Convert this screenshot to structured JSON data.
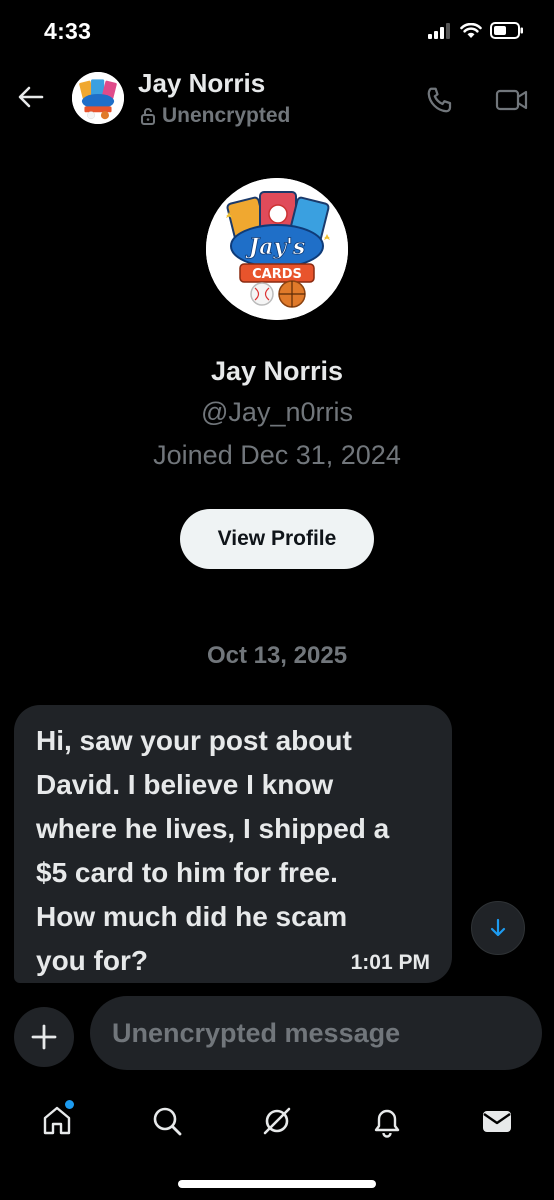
{
  "status_bar": {
    "time": "4:33"
  },
  "header": {
    "back_icon": "arrow-left-icon",
    "contact_name": "Jay Norris",
    "encryption_status": "Unencrypted",
    "call_icon": "phone-icon",
    "video_icon": "video-camera-icon"
  },
  "avatar": {
    "logo_text_top": "Jay's",
    "logo_text_bottom": "CARDS"
  },
  "profile": {
    "name": "Jay Norris",
    "handle": "@Jay_n0rris",
    "joined": "Joined Dec 31, 2024",
    "view_profile_label": "View Profile"
  },
  "conversation": {
    "date_divider": "Oct 13, 2025",
    "messages": [
      {
        "text": "Hi, saw your post about\nDavid. I believe I know\nwhere he lives, I shipped a\n$5 card to him for free.\nHow much did he scam\nyou for?",
        "time": "1:01 PM"
      }
    ]
  },
  "composer": {
    "placeholder": "Unencrypted message",
    "add_icon": "plus-icon"
  },
  "bottom_nav": {
    "items": [
      "home-icon",
      "search-icon",
      "grok-icon",
      "notifications-bell-icon",
      "messages-envelope-icon"
    ]
  },
  "colors": {
    "background": "#000000",
    "bubble": "#202327",
    "muted": "#71767b",
    "accent": "#1d9bf0"
  }
}
